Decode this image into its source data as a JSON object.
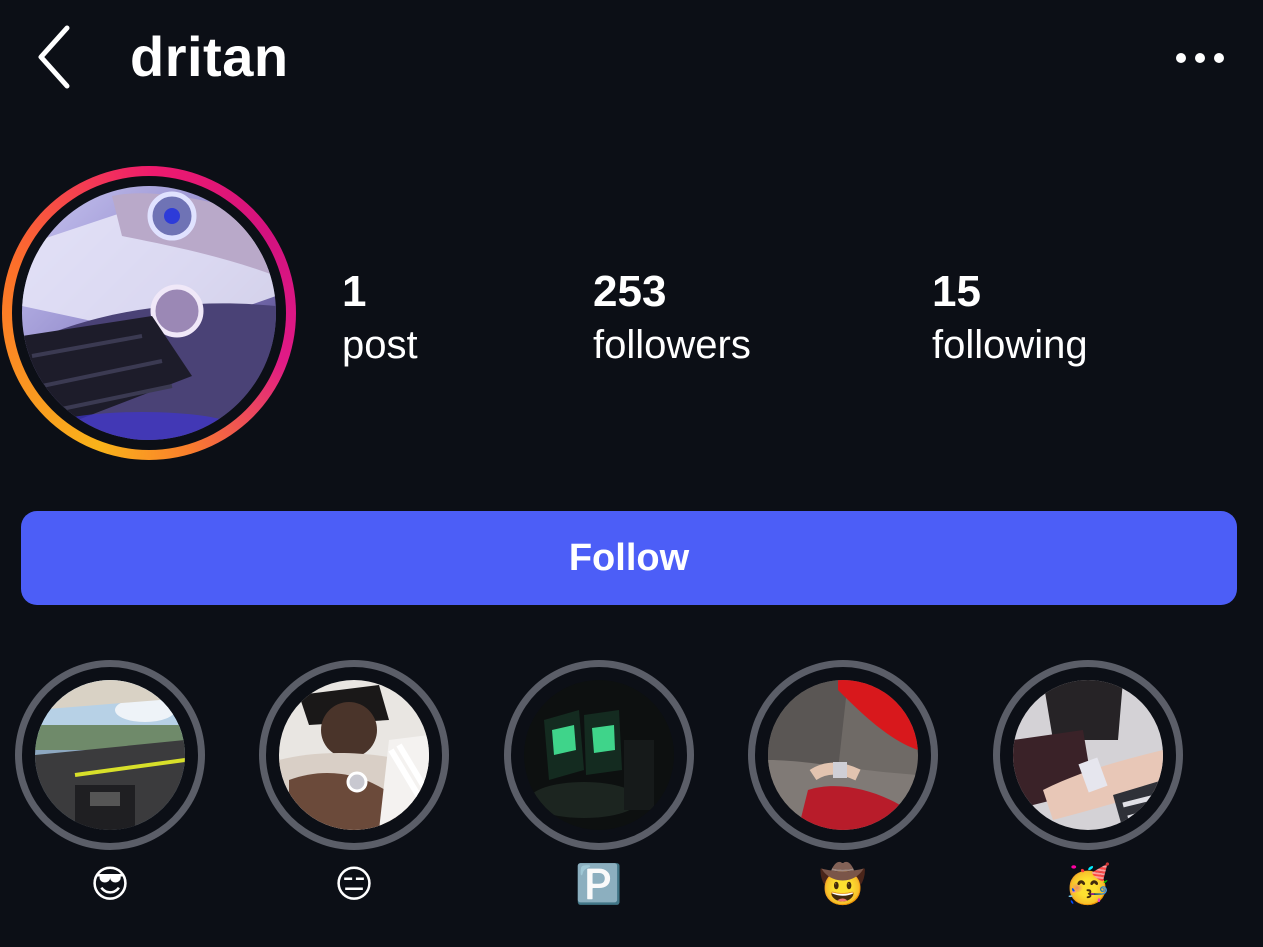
{
  "header": {
    "title": "dritan",
    "back_icon": "chevron-left-icon",
    "more_icon": "ellipsis-icon"
  },
  "profile": {
    "avatar_ring_colors": [
      "#f9b31a",
      "#ee1a6e",
      "#d3127f"
    ],
    "stats": [
      {
        "value": "1",
        "label": "post"
      },
      {
        "value": "253",
        "label": "followers"
      },
      {
        "value": "15",
        "label": "following"
      }
    ]
  },
  "follow_button": {
    "label": "Follow",
    "color": "#4c5ef7"
  },
  "highlights": [
    {
      "label": "😎"
    },
    {
      "label": "😑"
    },
    {
      "label": "🅿️"
    },
    {
      "label": "🤠"
    },
    {
      "label": "🥳"
    }
  ],
  "colors": {
    "background": "#0c0f16",
    "text": "#ffffff",
    "highlight_ring": "#5b5e68"
  }
}
